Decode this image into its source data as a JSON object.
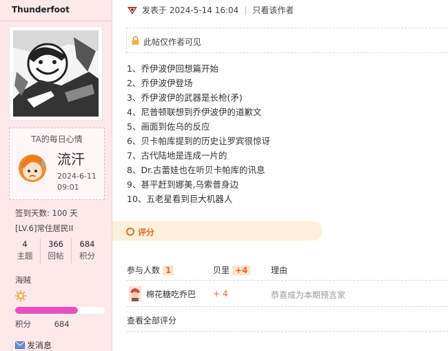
{
  "author": {
    "name": "Thunderfoot",
    "mood_title": "TA的每日心情",
    "mood_word": "流汗",
    "mood_date": "2024-6-11",
    "mood_time": "09:01",
    "signin": "签到天数: 100 天",
    "level": "[LV.6]常住居民II",
    "stats": [
      {
        "num": "4",
        "label": "主题"
      },
      {
        "num": "366",
        "label": "回帖"
      },
      {
        "num": "684",
        "label": "积分"
      }
    ],
    "group": "海贼",
    "points_label": "积分",
    "points_value": "684",
    "points_progress": 0.7,
    "pm_label": "发消息"
  },
  "post": {
    "posted_at": "发表于 2024-5-14 16:04",
    "author_only_link": "只看该作者",
    "notice": "此帖仅作者可见",
    "items": [
      "1、乔伊波伊回想篇开始",
      "2、乔伊波伊登场",
      "3、乔伊波伊的武器是长枪(矛)",
      "4、尼普顿联想到乔伊波伊的道歉文",
      "5、画面到佐乌的反应",
      "6、贝卡帕库提到的历史让罗宾很惊讶",
      "7、古代陆地是连成一片的",
      "8、Dr.古蕾娃也在听贝卡帕库的讯息",
      "9、甚平赶到娜美,乌索普身边",
      "10、五老星看到巨大机器人"
    ]
  },
  "rating": {
    "section_title": "评分",
    "participants_label": "参与人数",
    "participants_count": "1",
    "berry_label": "贝里",
    "berry_total": "+4",
    "reason_label": "理由",
    "rows": [
      {
        "user": "棉花糖吃乔巴",
        "points": "+ 4",
        "reason": "恭喜成为本期预言家"
      }
    ],
    "view_all": "查看全部评分"
  },
  "colors": {
    "sidebar_bg": "#fde8ea",
    "accent_orange": "#e8672a",
    "progress_pink": "#e84ec0",
    "rating_bg": "#fdf1d9"
  }
}
